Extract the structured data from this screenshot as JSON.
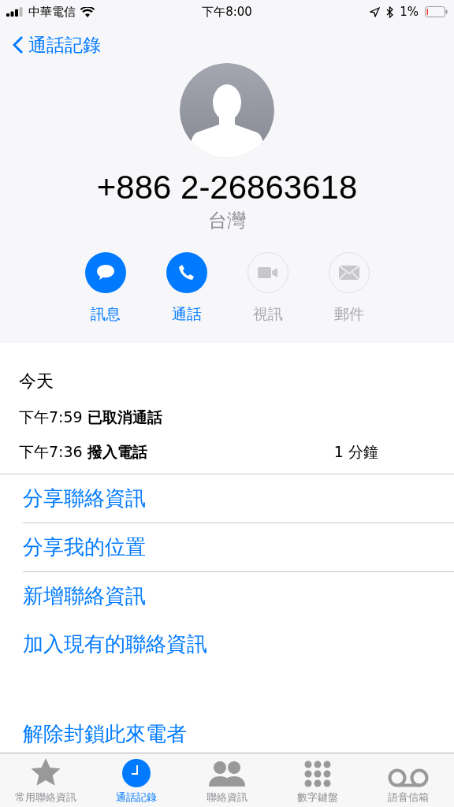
{
  "status_bar": {
    "carrier": "中華電信",
    "time": "下午8:00",
    "battery": "1%"
  },
  "nav": {
    "back": "通話記錄"
  },
  "contact": {
    "number": "+886 2-26863618",
    "region": "台灣"
  },
  "actions": [
    {
      "kind": "message",
      "label": "訊息",
      "disabled": false
    },
    {
      "kind": "call",
      "label": "通話",
      "disabled": false
    },
    {
      "kind": "video",
      "label": "視訊",
      "disabled": true
    },
    {
      "kind": "mail",
      "label": "郵件",
      "disabled": true
    }
  ],
  "history": {
    "heading": "今天",
    "entries": [
      {
        "time": "下午7:59",
        "type": "已取消通話"
      },
      {
        "time": "下午7:36",
        "type": "撥入電話",
        "duration": "1 分鐘"
      }
    ]
  },
  "options": [
    {
      "label": "分享聯絡資訊",
      "divider": false
    },
    {
      "label": "分享我的位置",
      "divider": true
    },
    {
      "label": "新增聯絡資訊",
      "divider": true
    },
    {
      "label": "加入現有的聯絡資訊",
      "divider": false
    }
  ],
  "block_caller": "解除封鎖此來電者",
  "tabs": [
    {
      "kind": "star",
      "label": "常用聯絡資訊",
      "selected": false
    },
    {
      "kind": "clock",
      "label": "通話記錄",
      "selected": true
    },
    {
      "kind": "people",
      "label": "聯絡資訊",
      "selected": false
    },
    {
      "kind": "keypad",
      "label": "數字鍵盤",
      "selected": false
    },
    {
      "kind": "voicemail",
      "label": "語音信箱",
      "selected": false
    }
  ]
}
